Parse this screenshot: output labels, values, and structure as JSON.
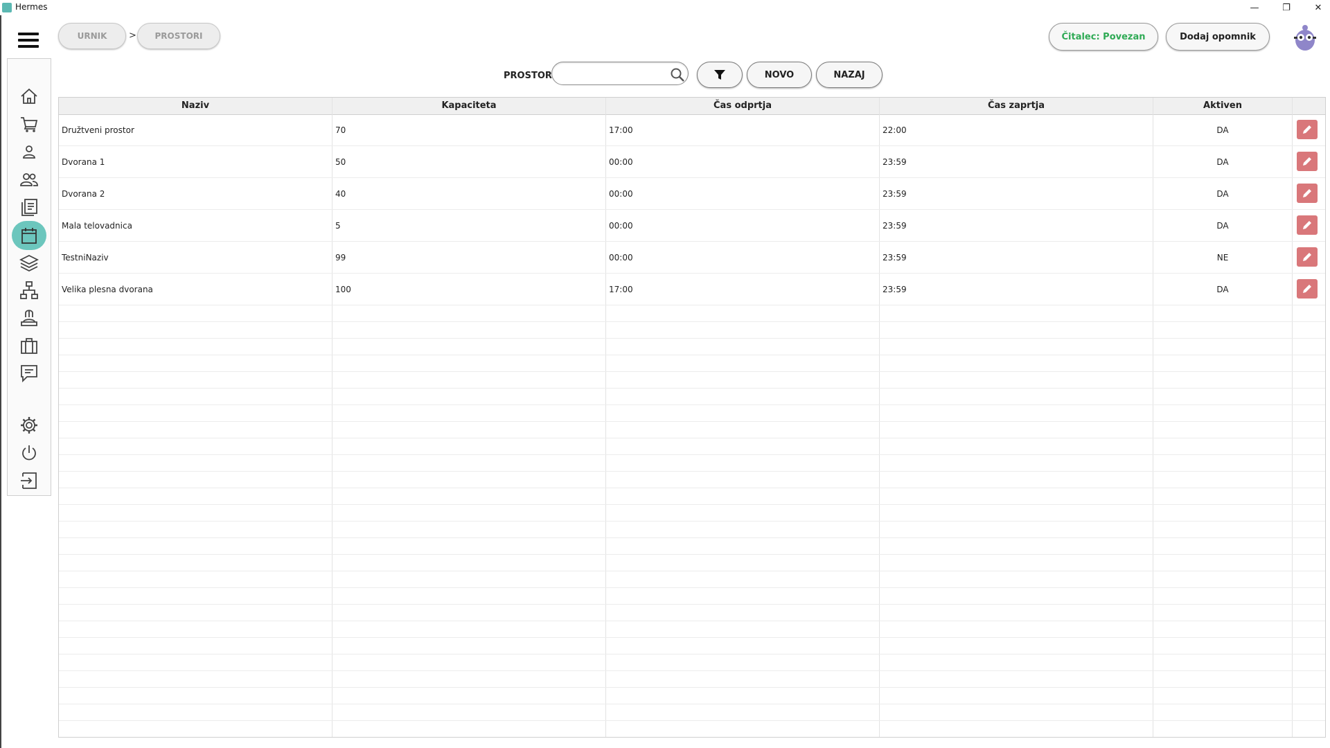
{
  "window": {
    "title": "Hermes",
    "min": "—",
    "max": "❐",
    "close": "✕"
  },
  "breadcrumb": [
    {
      "label": "URNIK"
    },
    {
      "label": "PROSTORI"
    }
  ],
  "breadcrumb_separator": ">",
  "header": {
    "reader_status": "Čitalec: Povezan",
    "add_reminder": "Dodaj opomnik"
  },
  "toolbar": {
    "label": "PROSTORI",
    "search_value": "",
    "search_placeholder": "",
    "new_button": "NOVO",
    "back_button": "NAZAJ"
  },
  "table": {
    "columns": [
      "Naziv",
      "Kapaciteta",
      "Čas odprtja",
      "Čas zaprtja",
      "Aktiven"
    ],
    "rows": [
      {
        "naziv": "Družtveni prostor",
        "kapaciteta": "70",
        "odprtje": "17:00",
        "zaprtje": "22:00",
        "aktiven": "DA"
      },
      {
        "naziv": "Dvorana 1",
        "kapaciteta": "50",
        "odprtje": "00:00",
        "zaprtje": "23:59",
        "aktiven": "DA"
      },
      {
        "naziv": "Dvorana 2",
        "kapaciteta": "40",
        "odprtje": "00:00",
        "zaprtje": "23:59",
        "aktiven": "DA"
      },
      {
        "naziv": "Mala telovadnica",
        "kapaciteta": "5",
        "odprtje": "00:00",
        "zaprtje": "23:59",
        "aktiven": "DA"
      },
      {
        "naziv": "TestniNaziv",
        "kapaciteta": "99",
        "odprtje": "00:00",
        "zaprtje": "23:59",
        "aktiven": "NE"
      },
      {
        "naziv": "Velika plesna dvorana",
        "kapaciteta": "100",
        "odprtje": "17:00",
        "zaprtje": "23:59",
        "aktiven": "DA"
      }
    ]
  },
  "sidebar": {
    "items": [
      {
        "icon": "home-icon"
      },
      {
        "icon": "cart-icon"
      },
      {
        "icon": "user-icon"
      },
      {
        "icon": "users-icon"
      },
      {
        "icon": "documents-icon"
      },
      {
        "icon": "calendar-icon",
        "active": true
      },
      {
        "icon": "layers-icon"
      },
      {
        "icon": "hierarchy-icon"
      },
      {
        "icon": "person-desk-icon"
      },
      {
        "icon": "briefcase-icon"
      },
      {
        "icon": "chat-icon"
      },
      {
        "icon": "gear-icon"
      },
      {
        "icon": "power-icon"
      },
      {
        "icon": "logout-icon"
      }
    ]
  },
  "colors": {
    "accent": "#6cc6bd",
    "edit": "#d9777a",
    "status_ok": "#2faa55"
  }
}
